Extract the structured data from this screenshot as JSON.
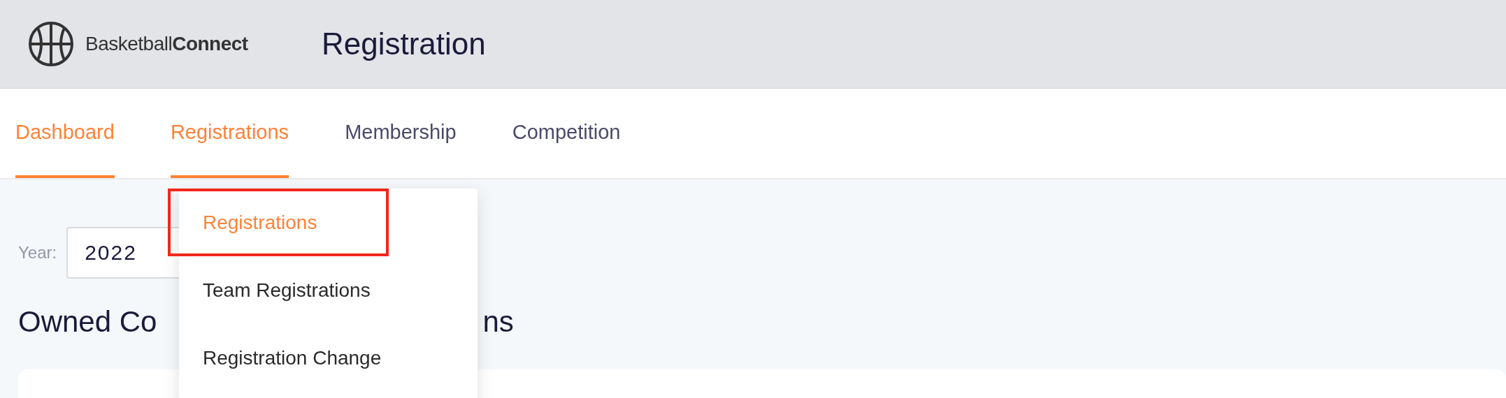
{
  "header": {
    "logo": {
      "text_light": "Basketball",
      "text_bold": "Connect"
    },
    "title": "Registration"
  },
  "nav": [
    {
      "label": "Dashboard",
      "selected": true
    },
    {
      "label": "Registrations",
      "selected": true
    },
    {
      "label": "Membership",
      "selected": false
    },
    {
      "label": "Competition",
      "selected": false
    }
  ],
  "dropdown": [
    {
      "label": "Registrations",
      "selected": true,
      "highlighted": true
    },
    {
      "label": "Team Registrations",
      "selected": false,
      "highlighted": false
    },
    {
      "label": "Registration Change",
      "selected": false,
      "highlighted": false
    }
  ],
  "filters": {
    "year_label": "Year:",
    "year_value": "2022"
  },
  "heading_parts": [
    "Owned Co",
    "ns"
  ]
}
